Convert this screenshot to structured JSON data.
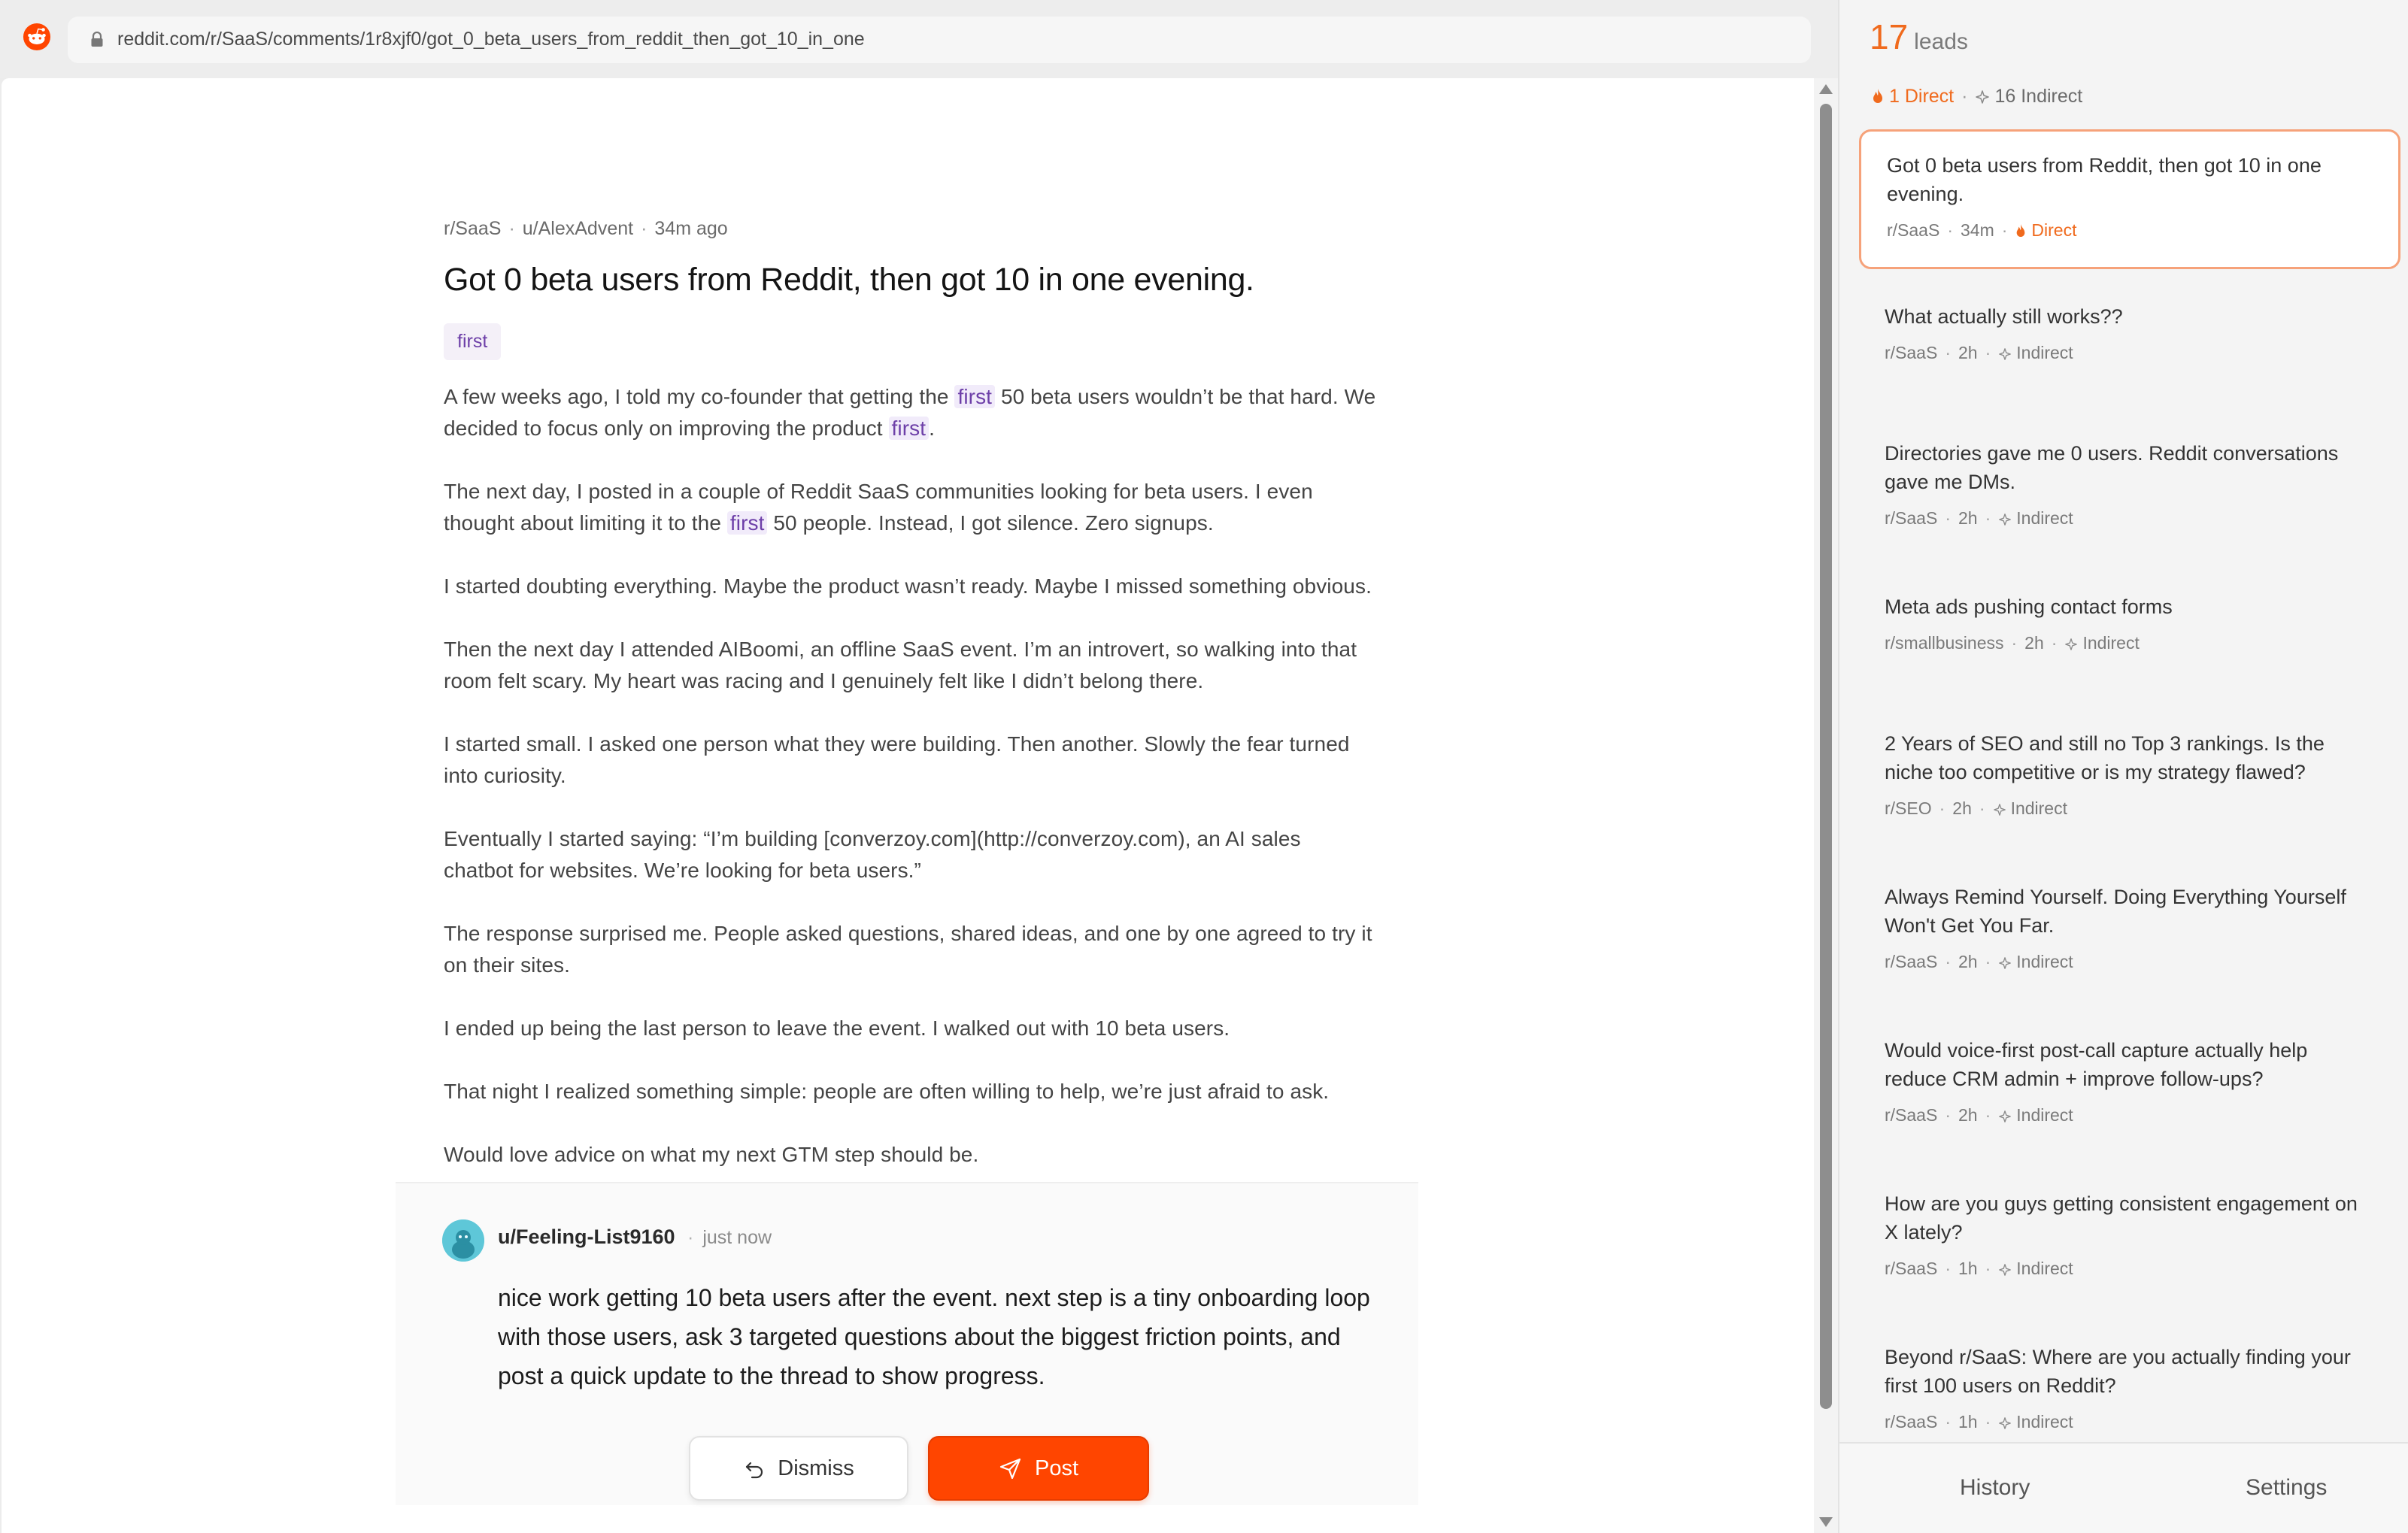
{
  "browser": {
    "url": "reddit.com/r/SaaS/comments/1r8xjf0/got_0_beta_users_from_reddit_then_got_10_in_one"
  },
  "post": {
    "subreddit": "r/SaaS",
    "author": "u/AlexAdvent",
    "time": "34m ago",
    "title": "Got 0 beta users from Reddit, then got 10 in one evening.",
    "tag": "first",
    "highlight_word": "first",
    "p1_a": "A few weeks ago, I told my co-founder that getting the ",
    "p1_b": " 50 beta users wouldn’t be that hard. We decided to focus only on improving the product ",
    "p1_c": ".",
    "p2_a": "The next day, I posted in a couple of Reddit SaaS communities looking for beta users. I even thought about limiting it to the ",
    "p2_b": " 50 people. Instead, I got silence. Zero signups.",
    "p3": "I started doubting everything. Maybe the product wasn’t ready. Maybe I missed something obvious.",
    "p4": "Then the next day I attended AIBoomi, an offline SaaS event. I’m an introvert, so walking into that room felt scary. My heart was racing and I genuinely felt like I didn’t belong there.",
    "p5": "I started small. I asked one person what they were building. Then another. Slowly the fear turned into curiosity.",
    "p6": "Eventually I started saying: “I’m building [converzoy.com](http://converzoy.com), an AI sales chatbot for websites. We’re looking for beta users.”",
    "p7": "The response surprised me. People asked questions, shared ideas, and one by one agreed to try it on their sites.",
    "p8": "I ended up being the last person to leave the event. I walked out with 10 beta users.",
    "p9": "That night I realized something simple: people are often willing to help, we’re just afraid to ask.",
    "p10": "Would love advice on what my next GTM step should be."
  },
  "reply": {
    "user": "u/Feeling-List9160",
    "time": "just now",
    "text": "nice work getting 10 beta users after the event. next step is a tiny onboarding loop with those users, ask 3 targeted questions about the biggest friction points, and post a quick update to the thread to show progress.",
    "dismiss_label": "Dismiss",
    "post_label": "Post"
  },
  "sidebar": {
    "count": "17",
    "count_label": "leads",
    "direct_filter": "1 Direct",
    "indirect_filter": "16 Indirect",
    "leads": [
      {
        "title": "Got 0 beta users from Reddit, then got 10 in one evening.",
        "sub": "r/SaaS",
        "age": "34m",
        "type": "Direct"
      },
      {
        "title": "What actually still works??",
        "sub": "r/SaaS",
        "age": "2h",
        "type": "Indirect"
      },
      {
        "title": "Directories gave me 0 users. Reddit conversations gave me DMs.",
        "sub": "r/SaaS",
        "age": "2h",
        "type": "Indirect"
      },
      {
        "title": "Meta ads pushing contact forms",
        "sub": "r/smallbusiness",
        "age": "2h",
        "type": "Indirect"
      },
      {
        "title": "2 Years of SEO and still no Top 3 rankings. Is the niche too competitive or is my strategy flawed?",
        "sub": "r/SEO",
        "age": "2h",
        "type": "Indirect"
      },
      {
        "title": "Always Remind Yourself. Doing Everything Yourself Won't Get You Far.",
        "sub": "r/SaaS",
        "age": "2h",
        "type": "Indirect"
      },
      {
        "title": "Would voice-first post-call capture actually help reduce CRM admin + improve follow-ups?",
        "sub": "r/SaaS",
        "age": "2h",
        "type": "Indirect"
      },
      {
        "title": "How are you guys getting consistent engagement on X lately?",
        "sub": "r/SaaS",
        "age": "1h",
        "type": "Indirect"
      },
      {
        "title": "Beyond r/SaaS: Where are you actually finding your first 100 users on Reddit?",
        "sub": "r/SaaS",
        "age": "1h",
        "type": "Indirect"
      }
    ],
    "footer": {
      "history": "History",
      "settings": "Settings"
    }
  },
  "colors": {
    "accent": "#f06a1d",
    "reddit_orange": "#ff4500",
    "highlight_purple": "#6d3fa8"
  },
  "icons": [
    "reddit-logo-icon",
    "lock-icon",
    "flame-icon",
    "sparkle-icon",
    "undo-arrow-icon",
    "send-icon",
    "avatar-icon"
  ]
}
